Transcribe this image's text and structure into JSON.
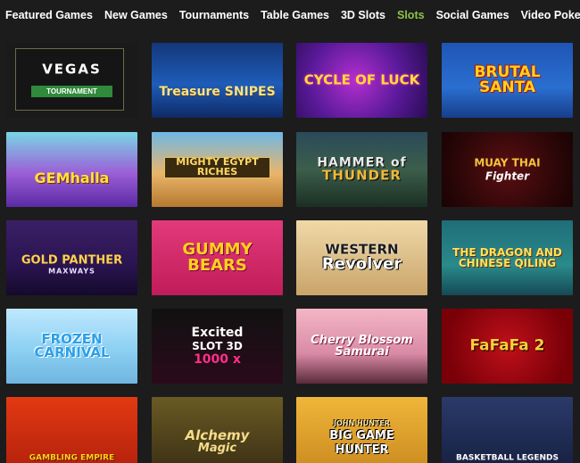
{
  "nav": {
    "items": [
      {
        "label": "Featured Games",
        "active": false
      },
      {
        "label": "New Games",
        "active": false
      },
      {
        "label": "Tournaments",
        "active": false
      },
      {
        "label": "Table Games",
        "active": false
      },
      {
        "label": "3D Slots",
        "active": false
      },
      {
        "label": "Slots",
        "active": true
      },
      {
        "label": "Social Games",
        "active": false
      },
      {
        "label": "Video Poker",
        "active": false
      }
    ],
    "active_color": "#8bc34a",
    "text_color": "#ffffff"
  },
  "games": {
    "vegas": {
      "title": "VEGAS",
      "sub": "TOURNAMENT"
    },
    "treasure": {
      "title": "Treasure SNIPES"
    },
    "cycle": {
      "title": "CYCLE OF LUCK"
    },
    "brutal": {
      "title": "BRUTAL SANTA"
    },
    "gem": {
      "title": "GEMhalla"
    },
    "egypt": {
      "title": "MIGHTY EGYPT RICHES"
    },
    "hammer": {
      "title": "HAMMER of",
      "title2": "THUNDER"
    },
    "muay": {
      "title": "MUAY THAI",
      "title2": "Fighter"
    },
    "panther": {
      "title": "GOLD PANTHER",
      "title2": "MAXWAYS"
    },
    "gummy": {
      "title": "GUMMY BEARS"
    },
    "western": {
      "title": "WESTERN",
      "title2": "Revolver"
    },
    "dragon": {
      "title": "THE DRAGON AND CHINESE QILING"
    },
    "frozen": {
      "title": "FROZEN CARNIVAL"
    },
    "excited": {
      "title": "Excited",
      "title2": "SLOT 3D",
      "title3": "1000 x"
    },
    "cherry": {
      "title": "Cherry Blossom Samurai"
    },
    "fafafa": {
      "title": "FaFaFa 2"
    },
    "gambling": {
      "title": "GAMBLING EMPIRE"
    },
    "alchemy": {
      "title": "Alchemy",
      "title2": "Magic"
    },
    "biggame": {
      "title": "JOHN HUNTER",
      "title2": "BIG GAME",
      "title3": "HUNTER"
    },
    "basket": {
      "title": "BASKETBALL LEGENDS"
    }
  }
}
